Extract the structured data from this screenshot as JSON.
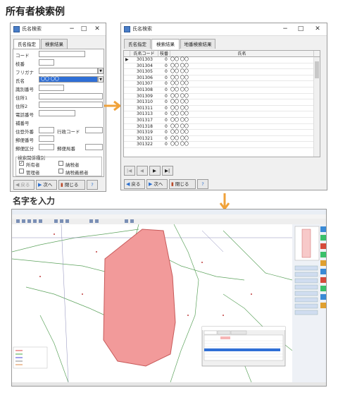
{
  "page_title": "所有者検索例",
  "caption": "名字を入力",
  "left_window": {
    "title": "氏名検索",
    "controls": [
      "−",
      "□",
      "✕"
    ],
    "tabs": [
      "氏名指定",
      "検索結果"
    ],
    "fields": [
      {
        "label": "コード",
        "value": ""
      },
      {
        "label": "枝番",
        "value": ""
      },
      {
        "label": "フリガナ",
        "value": ""
      },
      {
        "label": "氏名",
        "value": "〇〇 〇〇"
      },
      {
        "label": "識別番号",
        "value": ""
      },
      {
        "label": "住所1",
        "value": ""
      },
      {
        "label": "住所2",
        "value": ""
      },
      {
        "label": "電話番号",
        "value": ""
      },
      {
        "label": "補番号",
        "value": ""
      }
    ],
    "row_pairs": [
      {
        "left": "住登外番",
        "right": "行政コード"
      },
      {
        "left": "郵便番号",
        "right": ""
      },
      {
        "left": "郵便区分",
        "right": "郵便局番"
      }
    ],
    "group_label": "検索関係種別",
    "checkboxes": [
      {
        "label": "所有者",
        "checked": true
      },
      {
        "label": "納税者",
        "checked": false
      },
      {
        "label": "管理者",
        "checked": false
      },
      {
        "label": "納税義務者",
        "checked": false
      }
    ],
    "buttons": [
      "戻る",
      "次へ",
      "閉じる",
      "?"
    ]
  },
  "right_window": {
    "title": "氏名検索",
    "controls": [
      "−",
      "□",
      "✕"
    ],
    "tabs": [
      "氏名指定",
      "検索結果",
      "地番検索結果"
    ],
    "columns": [
      "氏名コード",
      "枝番",
      "氏名"
    ],
    "rows": [
      {
        "code": "301303",
        "branch": "0",
        "name": "〇〇 〇〇"
      },
      {
        "code": "301304",
        "branch": "0",
        "name": "〇〇 〇〇"
      },
      {
        "code": "301305",
        "branch": "0",
        "name": "〇〇 〇〇"
      },
      {
        "code": "301306",
        "branch": "0",
        "name": "〇〇 〇〇"
      },
      {
        "code": "301307",
        "branch": "0",
        "name": "〇〇 〇〇"
      },
      {
        "code": "301308",
        "branch": "0",
        "name": "〇〇 〇〇"
      },
      {
        "code": "301309",
        "branch": "0",
        "name": "〇〇 〇〇"
      },
      {
        "code": "301310",
        "branch": "0",
        "name": "〇〇 〇〇"
      },
      {
        "code": "301311",
        "branch": "0",
        "name": "〇〇 〇〇"
      },
      {
        "code": "301313",
        "branch": "0",
        "name": "〇〇 〇〇"
      },
      {
        "code": "301317",
        "branch": "0",
        "name": "〇〇 〇〇"
      },
      {
        "code": "301318",
        "branch": "0",
        "name": "〇〇 〇〇"
      },
      {
        "code": "301319",
        "branch": "0",
        "name": "〇〇 〇〇"
      },
      {
        "code": "301321",
        "branch": "0",
        "name": "〇〇 〇〇"
      },
      {
        "code": "301322",
        "branch": "0",
        "name": "〇〇 〇〇"
      }
    ],
    "nav_buttons": [
      "|◀",
      "◀",
      "▶",
      "▶|"
    ],
    "buttons": [
      "戻る",
      "次へ",
      "閉じる",
      "?"
    ]
  },
  "colors": {
    "accent_arrow": "#f0a23a",
    "parcel_fill": "#f29a9a",
    "selection": "#2f6fd6"
  }
}
